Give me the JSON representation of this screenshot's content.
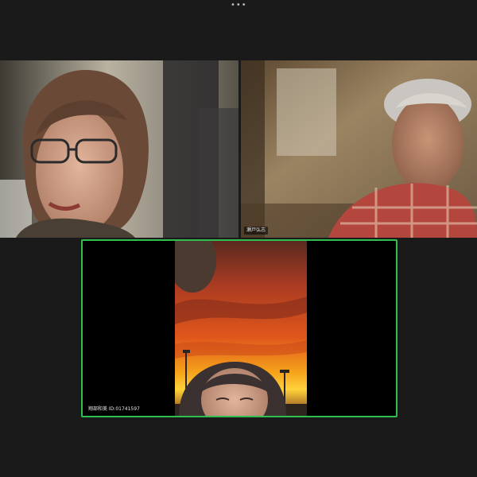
{
  "window": {
    "more_options_glyph": "•••"
  },
  "participants": [
    {
      "name": "",
      "icon": "participant-video"
    },
    {
      "name": "瀬戸弘志",
      "icon": "participant-video"
    },
    {
      "name": "翔部和美 ID:01741597",
      "icon": "participant-video",
      "active_speaker": true
    }
  ],
  "colors": {
    "background": "#1a1a1a",
    "active_speaker_border": "#2fbf4f"
  }
}
